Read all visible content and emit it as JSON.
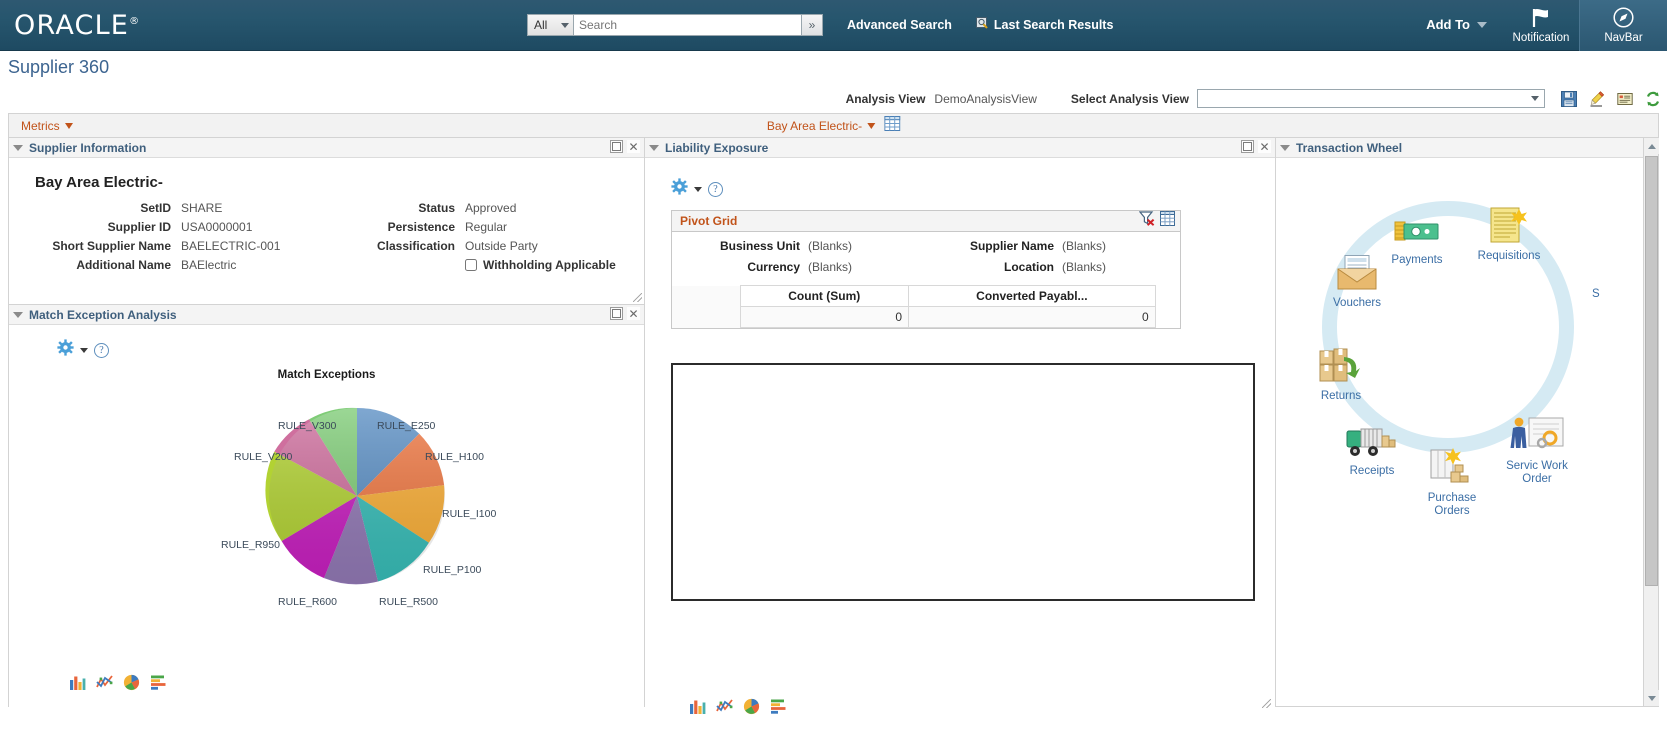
{
  "header": {
    "logo": "ORACLE",
    "search": {
      "category": "All",
      "placeholder": "Search",
      "value": "",
      "go_label": "»"
    },
    "advanced_search": "Advanced Search",
    "last_search_results": "Last Search Results",
    "add_to": "Add To",
    "notification": "Notification",
    "navbar": "NavBar"
  },
  "page": {
    "title": "Supplier 360",
    "analysis_view_label": "Analysis View",
    "analysis_view_value": "DemoAnalysisView",
    "select_analysis_view_label": "Select Analysis View",
    "select_analysis_view_value": "",
    "toolbar_icons": [
      "save-icon",
      "edit-icon",
      "notes-icon",
      "refresh-icon"
    ]
  },
  "metrics_bar": {
    "metrics_label": "Metrics",
    "supplier_label": "Bay Area Electric-",
    "grid_icon": "grid-icon"
  },
  "supplier_information": {
    "panel_title": "Supplier Information",
    "supplier_name": "Bay Area Electric-",
    "left_fields": [
      {
        "label": "SetID",
        "value": "SHARE"
      },
      {
        "label": "Supplier ID",
        "value": "USA0000001"
      },
      {
        "label": "Short Supplier Name",
        "value": "BAELECTRIC-001"
      },
      {
        "label": "Additional Name",
        "value": "BAElectric"
      }
    ],
    "right_fields": [
      {
        "label": "Status",
        "value": "Approved"
      },
      {
        "label": "Persistence",
        "value": "Regular"
      },
      {
        "label": "Classification",
        "value": "Outside Party"
      }
    ],
    "checkbox_label": "Withholding Applicable",
    "checkbox_checked": false
  },
  "match_exception_analysis": {
    "panel_title": "Match Exception Analysis",
    "chart_icons": [
      "bar-chart-icon",
      "line-chart-icon",
      "pie-chart-icon",
      "horizontal-bar-chart-icon"
    ]
  },
  "liability_exposure": {
    "panel_title": "Liability Exposure",
    "pivot_grid": {
      "title": "Pivot Grid",
      "icons": [
        "clear-filter-icon",
        "grid-view-icon"
      ],
      "facets": [
        {
          "label": "Business Unit",
          "value": "(Blanks)"
        },
        {
          "label": "Supplier Name",
          "value": "(Blanks)"
        },
        {
          "label": "Currency",
          "value": "(Blanks)"
        },
        {
          "label": "Location",
          "value": "(Blanks)"
        }
      ],
      "columns": [
        "Count (Sum)",
        "Converted Payabl..."
      ],
      "rows": [
        [
          "0",
          "0"
        ]
      ]
    },
    "chart_icons": [
      "bar-chart-icon",
      "line-chart-icon",
      "pie-chart-icon",
      "horizontal-bar-chart-icon"
    ]
  },
  "transaction_wheel": {
    "panel_title": "Transaction Wheel",
    "nodes": [
      {
        "label": "Payments",
        "icon": "money-icon"
      },
      {
        "label": "Requisitions",
        "icon": "requisition-document-icon"
      },
      {
        "label": "S",
        "icon": "truncated-icon"
      },
      {
        "label": "Vouchers",
        "icon": "envelope-voucher-icon"
      },
      {
        "label": "Returns",
        "icon": "return-boxes-icon"
      },
      {
        "label": "Receipts",
        "icon": "delivery-truck-icon"
      },
      {
        "label": "Purchase Orders",
        "icon": "purchase-order-icon"
      },
      {
        "label": "Servic Work Order",
        "icon": "service-work-order-icon"
      }
    ]
  },
  "chart_data": {
    "type": "pie",
    "title": "Match Exceptions",
    "categories": [
      "RULE_E250",
      "RULE_H100",
      "RULE_I100",
      "RULE_P100",
      "RULE_R500",
      "RULE_R600",
      "RULE_R950",
      "RULE_V200",
      "RULE_V300"
    ],
    "values": [
      11,
      11,
      11,
      11,
      11,
      11,
      18,
      9,
      11
    ],
    "colors": [
      "#5b8fc4",
      "#ef7843",
      "#f9ae36",
      "#38bdb8",
      "#9279b5",
      "#c81fc0",
      "#b2d233",
      "#cf6f9e",
      "#7fcc77"
    ],
    "legend": "labels",
    "xlabel": "",
    "ylabel": ""
  }
}
